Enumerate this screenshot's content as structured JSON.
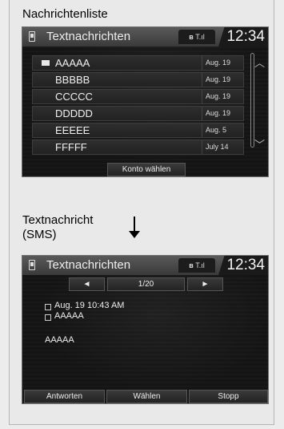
{
  "list_section": {
    "caption": "Nachrichtenliste",
    "header": {
      "title": "Textnachrichten",
      "status": "µ T.il",
      "clock": "12:34"
    },
    "rows": [
      {
        "name": "AAAAA",
        "date": "Aug. 19",
        "unread": true
      },
      {
        "name": "BBBBB",
        "date": "Aug. 19",
        "unread": false
      },
      {
        "name": "CCCCC",
        "date": "Aug. 19",
        "unread": false
      },
      {
        "name": "DDDDD",
        "date": "Aug. 19",
        "unread": false
      },
      {
        "name": "EEEEE",
        "date": "Aug. 5",
        "unread": false
      },
      {
        "name": "FFFFF",
        "date": "July 14",
        "unread": false
      }
    ],
    "scroll_up_icon": "chevron-up-icon",
    "scroll_down_icon": "chevron-down-icon",
    "account_button": "Konto wählen"
  },
  "detail_section": {
    "caption_line1": "Textnachricht",
    "caption_line2": "(SMS)",
    "header": {
      "title": "Textnachrichten",
      "status": "µ T.il",
      "clock": "12:34"
    },
    "prev_symbol": "◄",
    "next_symbol": "►",
    "page_indicator": "1/20",
    "timestamp": "Aug. 19 10:43 AM",
    "sender": "AAAAA",
    "body": "AAAAA",
    "buttons": [
      "Antworten",
      "Wählen",
      "Stopp"
    ]
  },
  "colors": {
    "screen_bg": "#141414",
    "header_bg": "#4a4a4a",
    "page_bg": "#e9e9e9"
  }
}
